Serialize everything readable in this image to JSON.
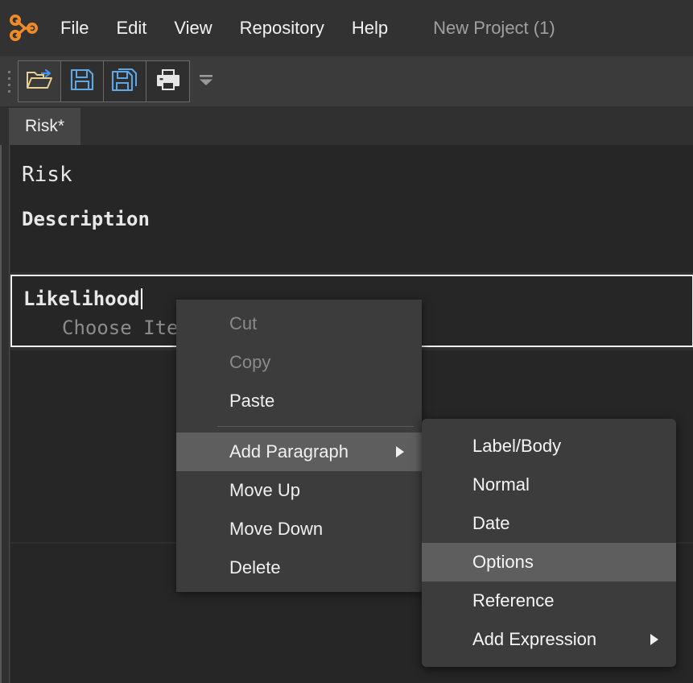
{
  "app": {
    "logo_icon": "node-graph-logo-icon",
    "background_color": "#303030"
  },
  "menubar": {
    "items": [
      {
        "label": "File",
        "name": "menu-file"
      },
      {
        "label": "Edit",
        "name": "menu-edit"
      },
      {
        "label": "View",
        "name": "menu-view"
      },
      {
        "label": "Repository",
        "name": "menu-repository"
      },
      {
        "label": "Help",
        "name": "menu-help"
      }
    ],
    "project_label": "New Project (1)"
  },
  "toolbar": {
    "buttons": [
      {
        "name": "open-file-button",
        "icon": "open-folder-icon",
        "color": "#e8cf93"
      },
      {
        "name": "save-button",
        "icon": "floppy-save-icon",
        "color": "#5ea8e8"
      },
      {
        "name": "save-as-button",
        "icon": "floppy-save-as-icon",
        "color": "#5ea8e8"
      },
      {
        "name": "print-button",
        "icon": "printer-icon",
        "color": "#e6e6e6"
      }
    ],
    "overflow_icon": "chevron-down-icon"
  },
  "tabs": [
    {
      "label": "Risk*",
      "name": "tab-risk",
      "active": true
    }
  ],
  "document": {
    "paragraphs": [
      {
        "name": "paragraph-risk-title",
        "text": "Risk",
        "style": "title"
      },
      {
        "name": "paragraph-description",
        "text": "Description",
        "style": "bold"
      },
      {
        "name": "paragraph-likelihood",
        "text": "Likelihood",
        "style": "bold",
        "selected": true
      },
      {
        "name": "paragraph-choose-item",
        "text": "Choose Item",
        "style": "placeholder"
      }
    ]
  },
  "context_menu": {
    "items": [
      {
        "label": "Cut",
        "name": "ctx-cut",
        "disabled": true,
        "highlight": false,
        "submenu": false
      },
      {
        "label": "Copy",
        "name": "ctx-copy",
        "disabled": true,
        "highlight": false,
        "submenu": false
      },
      {
        "label": "Paste",
        "name": "ctx-paste",
        "disabled": false,
        "highlight": false,
        "submenu": false
      },
      {
        "label": "Add Paragraph",
        "name": "ctx-add-paragraph",
        "disabled": false,
        "highlight": true,
        "submenu": true
      },
      {
        "label": "Move Up",
        "name": "ctx-move-up",
        "disabled": false,
        "highlight": false,
        "submenu": false
      },
      {
        "label": "Move Down",
        "name": "ctx-move-down",
        "disabled": false,
        "highlight": false,
        "submenu": false
      },
      {
        "label": "Delete",
        "name": "ctx-delete",
        "disabled": false,
        "highlight": false,
        "submenu": false
      }
    ],
    "separator_after_index": 2
  },
  "submenu": {
    "items": [
      {
        "label": "Label/Body",
        "name": "sub-label-body",
        "highlight": false,
        "submenu": false
      },
      {
        "label": "Normal",
        "name": "sub-normal",
        "highlight": false,
        "submenu": false
      },
      {
        "label": "Date",
        "name": "sub-date",
        "highlight": false,
        "submenu": false
      },
      {
        "label": "Options",
        "name": "sub-options",
        "highlight": true,
        "submenu": false
      },
      {
        "label": "Reference",
        "name": "sub-reference",
        "highlight": false,
        "submenu": false
      },
      {
        "label": "Add Expression",
        "name": "sub-add-expression",
        "highlight": false,
        "submenu": true
      }
    ]
  },
  "colors": {
    "menubar_bg": "#323232",
    "toolbar_bg": "#3b3b3b",
    "panel_bg": "#262626",
    "menu_bg": "#3c3c3c",
    "highlight": "#5e5e5e",
    "accent_orange": "#f08c28",
    "selection_border": "#f0f0f0"
  }
}
